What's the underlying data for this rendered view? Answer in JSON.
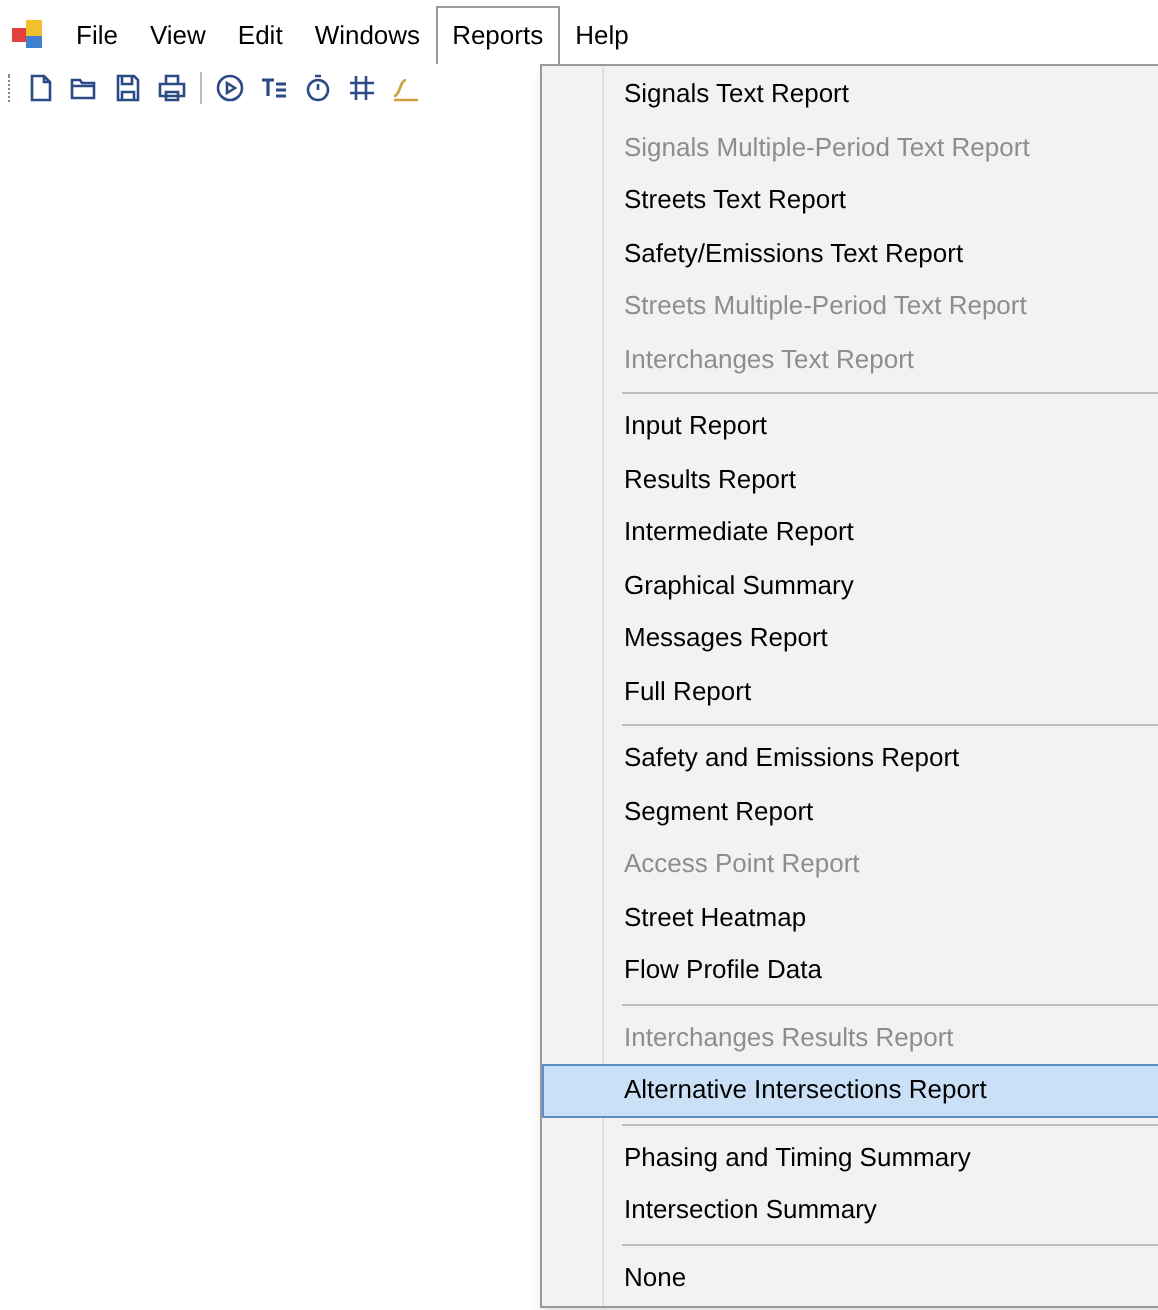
{
  "menu_bar": [
    {
      "label": "File",
      "selected": false
    },
    {
      "label": "View",
      "selected": false
    },
    {
      "label": "Edit",
      "selected": false
    },
    {
      "label": "Windows",
      "selected": false
    },
    {
      "label": "Reports",
      "selected": true
    },
    {
      "label": "Help",
      "selected": false
    }
  ],
  "reports_menu": {
    "groups": [
      {
        "items": [
          {
            "label": "Signals Text Report",
            "disabled": false,
            "selected": false
          },
          {
            "label": "Signals Multiple-Period Text Report",
            "disabled": true,
            "selected": false
          },
          {
            "label": "Streets Text Report",
            "disabled": false,
            "selected": false
          },
          {
            "label": "Safety/Emissions Text Report",
            "disabled": false,
            "selected": false
          },
          {
            "label": "Streets Multiple-Period Text Report",
            "disabled": true,
            "selected": false
          },
          {
            "label": "Interchanges Text Report",
            "disabled": true,
            "selected": false
          }
        ]
      },
      {
        "items": [
          {
            "label": "Input Report",
            "disabled": false,
            "selected": false
          },
          {
            "label": "Results Report",
            "disabled": false,
            "selected": false
          },
          {
            "label": "Intermediate Report",
            "disabled": false,
            "selected": false
          },
          {
            "label": "Graphical Summary",
            "disabled": false,
            "selected": false
          },
          {
            "label": "Messages Report",
            "disabled": false,
            "selected": false
          },
          {
            "label": "Full Report",
            "disabled": false,
            "selected": false
          }
        ]
      },
      {
        "items": [
          {
            "label": "Safety and Emissions Report",
            "disabled": false,
            "selected": false
          },
          {
            "label": "Segment Report",
            "disabled": false,
            "selected": false
          },
          {
            "label": "Access Point Report",
            "disabled": true,
            "selected": false
          },
          {
            "label": "Street Heatmap",
            "disabled": false,
            "selected": false
          },
          {
            "label": "Flow Profile Data",
            "disabled": false,
            "selected": false
          }
        ]
      },
      {
        "items": [
          {
            "label": "Interchanges Results Report",
            "disabled": true,
            "selected": false
          },
          {
            "label": "Alternative Intersections Report",
            "disabled": false,
            "selected": true
          }
        ]
      },
      {
        "items": [
          {
            "label": "Phasing and Timing Summary",
            "disabled": false,
            "selected": false
          },
          {
            "label": "Intersection Summary",
            "disabled": false,
            "selected": false
          }
        ]
      },
      {
        "items": [
          {
            "label": "None",
            "disabled": false,
            "selected": false
          }
        ]
      }
    ]
  }
}
